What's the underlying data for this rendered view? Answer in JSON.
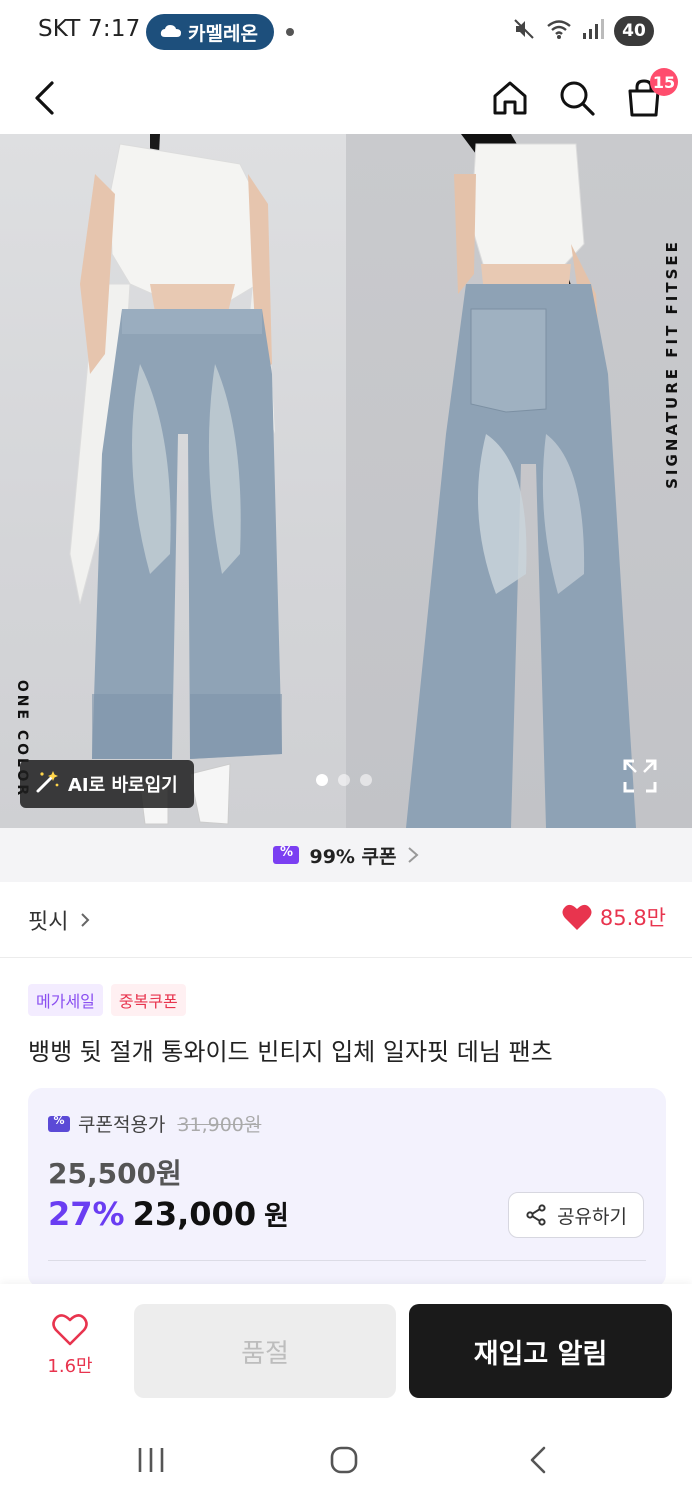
{
  "status_bar": {
    "carrier_time": "SKT 7:17",
    "pill_label": "카멜레온",
    "battery": "40"
  },
  "nav": {
    "cart_count": "15"
  },
  "gallery": {
    "side_text_right": "SIGNATURE FIT    FITSEE",
    "side_text_left": "ONE COLOR",
    "ai_button": "AI로 바로입기",
    "slide_count": 3,
    "active_slide": 1
  },
  "coupon_strip": {
    "label": "99% 쿠폰"
  },
  "brand": {
    "name": "핏시",
    "likes": "85.8만"
  },
  "badges": [
    "메가세일",
    "중복쿠폰"
  ],
  "product_title": "뱅뱅 뒷 절개 통와이드 빈티지 입체 일자핏 데님 팬츠",
  "price": {
    "coupon_label": "쿠폰적용가",
    "original_price": "31,900원",
    "coupon_price": "25,500원",
    "discount": "27%",
    "final_amount": "23,000",
    "final_unit": "원",
    "share_label": "공유하기"
  },
  "action_bar": {
    "wish_count": "1.6만",
    "soldout_label": "품절",
    "restock_label": "재입고 알림"
  },
  "colors": {
    "accent_purple": "#6a3df2",
    "like_red": "#e8344e",
    "badge_red": "#ff4d6d",
    "dark_button": "#1a1a1a"
  }
}
